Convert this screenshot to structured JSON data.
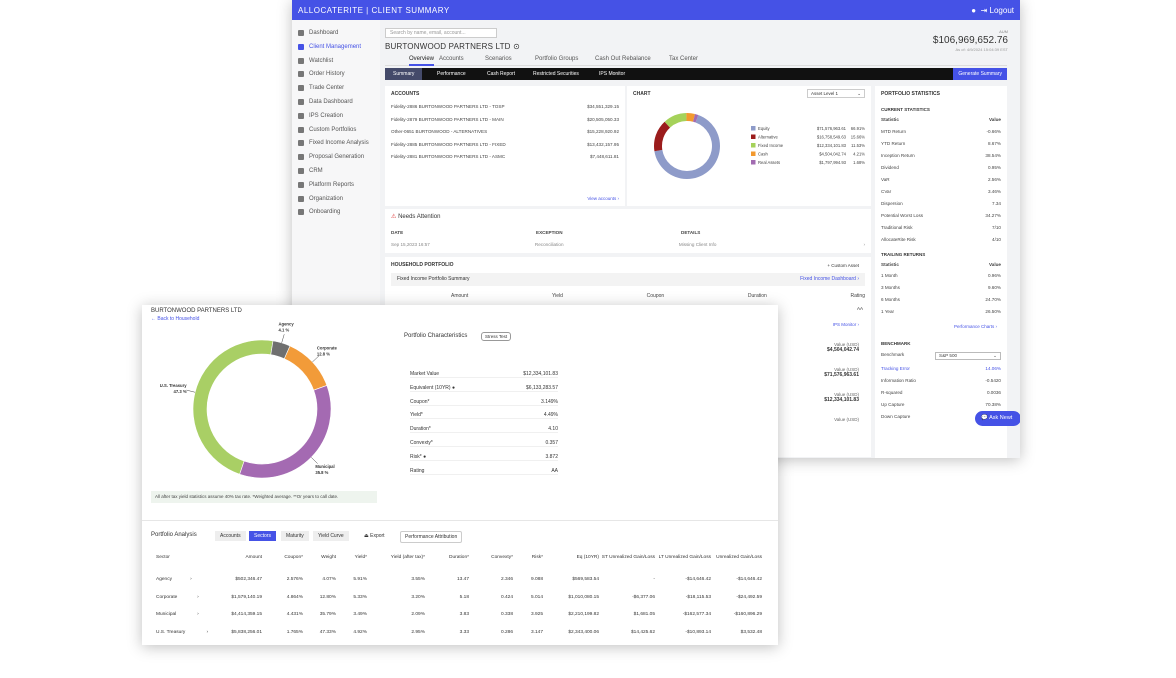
{
  "colors": {
    "accent": "#4552e6",
    "equity": "#8e9bc9",
    "alternative": "#9b1c1c",
    "fixed_income": "#a5d25a",
    "cash": "#f2992e",
    "real_assets": "#a26bb1",
    "treasury": "#a9cf65",
    "agency": "#6f6f6f",
    "corporate": "#f29b39",
    "municipal": "#a46ab2"
  },
  "header": {
    "brand": "ALLOCATERITE | CLIENT SUMMARY",
    "logout": "Logout"
  },
  "sidebar": {
    "items": [
      {
        "label": "Dashboard",
        "icon": "home-icon"
      },
      {
        "label": "Client Management",
        "icon": "users-icon",
        "active": true
      },
      {
        "label": "Watchlist",
        "icon": "bookmark-icon"
      },
      {
        "label": "Order History",
        "icon": "history-icon"
      },
      {
        "label": "Trade Center",
        "icon": "trade-icon"
      },
      {
        "label": "Data Dashboard",
        "icon": "data-icon"
      },
      {
        "label": "IPS Creation",
        "icon": "document-icon"
      },
      {
        "label": "Custom Portfolios",
        "icon": "portfolio-icon"
      },
      {
        "label": "Fixed Income Analysis",
        "icon": "chart-icon"
      },
      {
        "label": "Proposal Generation",
        "icon": "proposal-icon"
      },
      {
        "label": "CRM",
        "icon": "crm-icon"
      },
      {
        "label": "Platform Reports",
        "icon": "reports-icon"
      },
      {
        "label": "Organization",
        "icon": "building-icon"
      },
      {
        "label": "Onboarding",
        "icon": "onboarding-icon"
      }
    ]
  },
  "search": {
    "placeholder": "Search by name, email, account..."
  },
  "client": {
    "name": "BURTONWOOD PARTNERS LTD",
    "aum_label": "AUM",
    "aum": "$106,969,652.76",
    "as_of": "As of: 4/9/2024 15:04:39 EST"
  },
  "tabs": [
    "Overview",
    "Accounts",
    "Scenarios",
    "Portfolio Groups",
    "Cash Out Rebalance",
    "Tax Center"
  ],
  "subtabs": [
    "Summary",
    "Performance",
    "Cash Report",
    "Restricted Securities",
    "IPS Monitor"
  ],
  "generate_summary": "Generate Summary",
  "accounts": {
    "title": "ACCOUNTS",
    "rows": [
      {
        "name": "Fidelity-2886 BURTONWOOD PARTNERS LTD - TOSP",
        "value": "$34,551,329.15"
      },
      {
        "name": "Fidelity-2879 BURTONWOOD PARTNERS LTD - MAIN",
        "value": "$20,505,050.33"
      },
      {
        "name": "Other-0651 BURTONWOOD - ALTERNATIVES",
        "value": "$15,228,920.92"
      },
      {
        "name": "Fidelity-2885 BURTONWOOD PARTNERS LTD - FIXED",
        "value": "$13,432,157.95"
      },
      {
        "name": "Fidelity-2881 BURTONWOOD PARTNERS LTD - ASMC",
        "value": "$7,448,611.81"
      }
    ],
    "view": "View accounts"
  },
  "chart": {
    "title": "CHART",
    "select": "Asset Level 1"
  },
  "chart_data": [
    {
      "type": "pie",
      "title": "",
      "categories": [
        "Equity",
        "Alternative",
        "Fixed Income",
        "Cash",
        "Real Assets"
      ],
      "values": [
        66.91,
        15.66,
        11.53,
        4.21,
        1.68
      ],
      "amounts": [
        "$71,576,963.61",
        "$16,758,549.63",
        "$12,334,101.83",
        "$4,504,042.74",
        "$1,797,994.93"
      ],
      "percents": [
        "66.91%",
        "15.66%",
        "11.53%",
        "4.21%",
        "1.68%"
      ]
    },
    {
      "type": "pie",
      "title": "",
      "categories": [
        "U.S. Treasury",
        "Agency",
        "Corporate",
        "Municipal"
      ],
      "values": [
        47.3,
        4.1,
        12.8,
        35.8
      ],
      "labels": [
        "47.3 %",
        "4.1 %",
        "12.8 %",
        "35.8 %"
      ]
    }
  ],
  "attention": {
    "title": "Needs Attention",
    "cols": [
      "DATE",
      "EXCEPTION",
      "DETAILS"
    ],
    "row": [
      "Sep 15,2023 16:57",
      "Reconciliation",
      "Missing Client Info"
    ]
  },
  "household": {
    "title": "HOUSEHOLD PORTFOLIO",
    "custom": "Custom Asset",
    "fixed_title": "Fixed Income Portfolio Summary",
    "dashboard": "Fixed Income Dashboard",
    "cols": [
      "Amount",
      "Yield",
      "Coupon",
      "Duration",
      "Rating"
    ],
    "rating": "AA",
    "ips": "IPS Monitor",
    "values": [
      {
        "label": "Value (USD)",
        "value": "$4,504,042.74"
      },
      {
        "label": "Value (USD)",
        "value": "$71,576,963.61"
      },
      {
        "label": "Value (USD)",
        "value": "$12,334,101.83"
      },
      {
        "label": "Value (USD)",
        "value": ""
      }
    ]
  },
  "stats": {
    "title": "PORTFOLIO STATISTICS",
    "current": "CURRENT STATISTICS",
    "head": [
      "Statistic",
      "Value"
    ],
    "rows": [
      [
        "MTD Return",
        "-0.66%"
      ],
      [
        "YTD Return",
        "8.67%"
      ],
      [
        "Inception Return",
        "38.54%"
      ],
      [
        "Dividend",
        "0.95%"
      ],
      [
        "VaR",
        "2.56%"
      ],
      [
        "CVar",
        "3.46%"
      ],
      [
        "Dispersion",
        "7.34"
      ],
      [
        "Potential Worst Loss",
        "34.27%"
      ],
      [
        "Traditional Risk",
        "7/10"
      ],
      [
        "AllocateRite Risk",
        "4/10"
      ]
    ],
    "trailing": "TRAILING RETURNS",
    "trail_rows": [
      [
        "1 Month",
        "0.96%"
      ],
      [
        "3 Months",
        "9.60%"
      ],
      [
        "6 Months",
        "24.70%"
      ],
      [
        "1 Year",
        "26.50%"
      ]
    ],
    "perf_charts": "Performance Charts",
    "benchmark": "BENCHMARK",
    "bench_label": "Benchmark",
    "bench_value": "S&P 500",
    "bench_rows": [
      [
        "Tracking Error",
        "14.06%"
      ],
      [
        "Information Ratio",
        "-0.5420"
      ],
      [
        "R-squared",
        "0.0036"
      ],
      [
        "Up Capture",
        "70.38%"
      ],
      [
        "Down Capture",
        ""
      ]
    ]
  },
  "ask": "Ask Newt",
  "front": {
    "title": "BURTONWOOD PARTNERS LTD",
    "back": "← Back to Household",
    "chars_title": "Portfolio Characteristics",
    "stress": "Stress Test",
    "chars": [
      [
        "Market Value",
        "$12,334,101.83"
      ],
      [
        "Equivalent (10YR)",
        "$6,133,283.57"
      ],
      [
        "Coupon*",
        "3.149%"
      ],
      [
        "Yield*",
        "4.49%"
      ],
      [
        "Duration*",
        "4.10"
      ],
      [
        "Convexty*",
        "0.357"
      ],
      [
        "Risk*",
        "3.872"
      ],
      [
        "Rating",
        "AA"
      ]
    ],
    "note": "All after tax yield statistics assume 40% tax rate. *Weighted average. **Or years to call date.",
    "analysis": "Portfolio Analysis",
    "pills": [
      "Accounts",
      "Sectors",
      "Maturity",
      "Yield Curve"
    ],
    "export": "Export",
    "attribution": "Performance Attribution",
    "cols": [
      "Sector",
      "Amount",
      "Coupon*",
      "Weight",
      "Yield*",
      "Yield (after tax)*",
      "Duration*",
      "Convexty*",
      "Risk*",
      "Eq (10YR)",
      "ST Unrealized Gain/Loss",
      "LT Unrealized Gain/Loss",
      "Unrealized Gain/Loss"
    ],
    "rows": [
      [
        "Agency",
        "$502,346.47",
        "2.576%",
        "4.07%",
        "5.91%",
        "3.55%",
        "13.47",
        "2.346",
        "9.088",
        "$569,583.54",
        "-",
        "-$14,646.42",
        "-$14,646.42"
      ],
      [
        "Corporate",
        "$1,579,140.19",
        "4.864%",
        "12.80%",
        "5.33%",
        "3.20%",
        "5.18",
        "0.424",
        "5.014",
        "$1,010,080.15",
        "-$6,377.06",
        "-$18,115.53",
        "-$24,492.59"
      ],
      [
        "Municipal",
        "$4,414,359.15",
        "4.431%",
        "35.79%",
        "3.49%",
        "2.09%",
        "3.83",
        "0.338",
        "3.925",
        "$2,210,199.82",
        "$1,681.05",
        "-$162,577.34",
        "-$160,896.29"
      ],
      [
        "U.S. Treasury",
        "$5,838,256.01",
        "1.765%",
        "47.33%",
        "4.92%",
        "2.95%",
        "3.33",
        "0.286",
        "3.147",
        "$2,343,400.06",
        "$14,425.62",
        "-$10,893.14",
        "$3,532.48"
      ]
    ]
  }
}
